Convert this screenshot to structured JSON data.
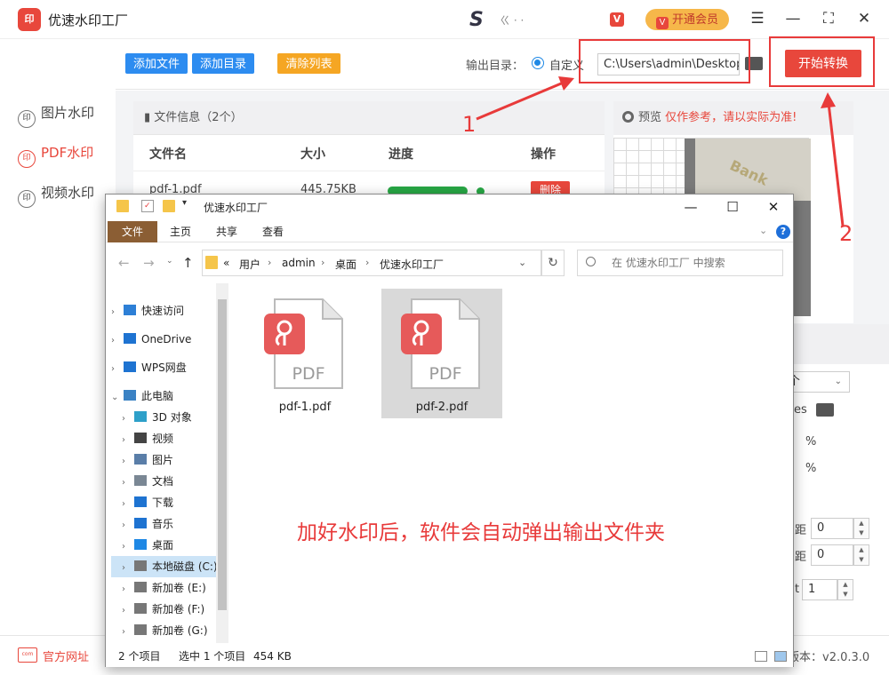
{
  "app": {
    "logo_text": "印",
    "title": "优速水印工厂",
    "user_mark": "S",
    "user_name": "ㄍ ·  ·",
    "vip_icon": "V",
    "vip_badge": "V",
    "vip_label": "开通会员",
    "controls": {
      "menu": "☰",
      "minimize": "—",
      "maximize": "⛶",
      "close": "✕"
    }
  },
  "sidebar": {
    "items": [
      {
        "label": "图片水印",
        "icon": "印"
      },
      {
        "label": "PDF水印",
        "icon": "印"
      },
      {
        "label": "视频水印",
        "icon": "印"
      }
    ]
  },
  "toolbar": {
    "add_file": "添加文件",
    "add_dir": "添加目录",
    "clear_list": "清除列表",
    "output_label": "输出目录：",
    "custom_label": "自定义",
    "output_path": "C:\\Users\\admin\\Desktop",
    "start_button": "开始转换",
    "colors": {
      "blue": "#2d8cf0",
      "orange": "#f5a623",
      "red": "#e8473c"
    }
  },
  "file_list": {
    "header": "文件信息（2个）",
    "columns": [
      "文件名",
      "大小",
      "进度",
      "操作"
    ],
    "rows": [
      {
        "name": "pdf-1.pdf",
        "size": "445.75KB",
        "action": "删除"
      }
    ]
  },
  "preview": {
    "label": "预览",
    "warning": "仅作参考，请以实际为准!",
    "watermark": "Bank"
  },
  "settings": {
    "select_value": "个",
    "path_fragment": "es",
    "percent1": "%",
    "percent2": "%",
    "label_a": "距",
    "value_a": "0",
    "label_b": "距",
    "value_b": "0",
    "label_c": "t",
    "value_c": "1"
  },
  "status": {
    "site_icon": "com",
    "site_label": "官方网址",
    "version": "版本：v2.0.3.0"
  },
  "annotations": {
    "num1": "1",
    "num2": "2",
    "message": "加好水印后，软件会自动弹出输出文件夹"
  },
  "explorer": {
    "title": "优速水印工厂",
    "controls": {
      "minimize": "—",
      "maximize": "☐",
      "close": "✕"
    },
    "tabs": [
      "文件",
      "主页",
      "共享",
      "查看"
    ],
    "help": "?",
    "breadcrumb": [
      "«",
      "用户",
      "admin",
      "桌面",
      "优速水印工厂"
    ],
    "search_placeholder": "在 优速水印工厂 中搜索",
    "nav": [
      {
        "label": "快速访问",
        "icon": "star-icon",
        "level": 0,
        "chev": "›"
      },
      {
        "label": "OneDrive",
        "icon": "cloud-icon",
        "level": 0,
        "chev": "›"
      },
      {
        "label": "WPS网盘",
        "icon": "cloud-icon",
        "level": 0,
        "chev": "›"
      },
      {
        "label": "此电脑",
        "icon": "computer-icon",
        "level": 0,
        "chev": "⌄"
      },
      {
        "label": "3D 对象",
        "icon": "cube-icon",
        "level": 1,
        "chev": "›"
      },
      {
        "label": "视频",
        "icon": "video-icon",
        "level": 1,
        "chev": "›"
      },
      {
        "label": "图片",
        "icon": "picture-icon",
        "level": 1,
        "chev": "›"
      },
      {
        "label": "文档",
        "icon": "document-icon",
        "level": 1,
        "chev": "›"
      },
      {
        "label": "下载",
        "icon": "download-icon",
        "level": 1,
        "chev": "›"
      },
      {
        "label": "音乐",
        "icon": "music-icon",
        "level": 1,
        "chev": "›"
      },
      {
        "label": "桌面",
        "icon": "desktop-icon",
        "level": 1,
        "chev": "›"
      },
      {
        "label": "本地磁盘 (C:)",
        "icon": "drive-icon",
        "level": 1,
        "chev": "›"
      },
      {
        "label": "新加卷 (E:)",
        "icon": "drive-icon",
        "level": 1,
        "chev": "›"
      },
      {
        "label": "新加卷 (F:)",
        "icon": "drive-icon",
        "level": 1,
        "chev": "›"
      },
      {
        "label": "新加卷 (G:)",
        "icon": "drive-icon",
        "level": 1,
        "chev": "›"
      }
    ],
    "files": [
      {
        "name": "pdf-1.pdf",
        "badge": "PDF",
        "selected": false
      },
      {
        "name": "pdf-2.pdf",
        "badge": "PDF",
        "selected": true
      }
    ],
    "status": {
      "count": "2 个项目",
      "selected": "选中 1 个项目",
      "size": "454 KB"
    }
  }
}
